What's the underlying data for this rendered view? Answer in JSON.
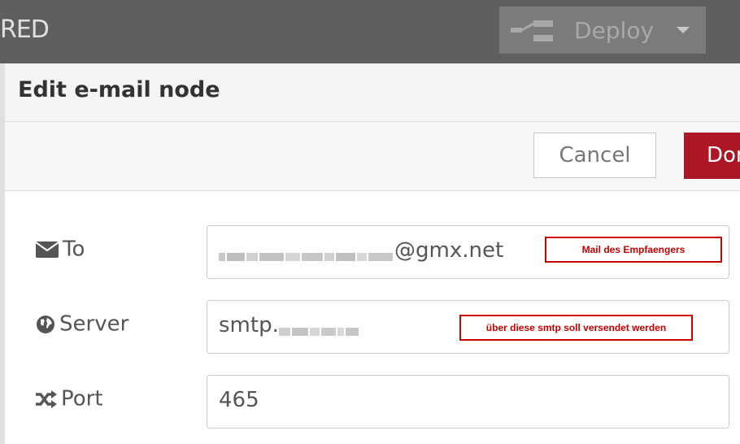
{
  "header": {
    "title": "RED",
    "deploy_label": "Deploy"
  },
  "tray": {
    "title": "Edit e-mail node",
    "cancel_label": "Cancel",
    "done_label": "Done"
  },
  "form": {
    "to": {
      "label": "To",
      "icon": "envelope-icon",
      "value_suffix": "@gmx.net",
      "annotation": "Mail des Empfaengers"
    },
    "server": {
      "label": "Server",
      "icon": "globe-icon",
      "value_prefix": "smtp.",
      "annotation": "über diese smtp soll versendet werden"
    },
    "port": {
      "label": "Port",
      "icon": "shuffle-icon",
      "value": "465"
    }
  },
  "colors": {
    "header_bg": "#5f5f5f",
    "done_bg": "#ad1625",
    "annotation": "#cc0000"
  }
}
